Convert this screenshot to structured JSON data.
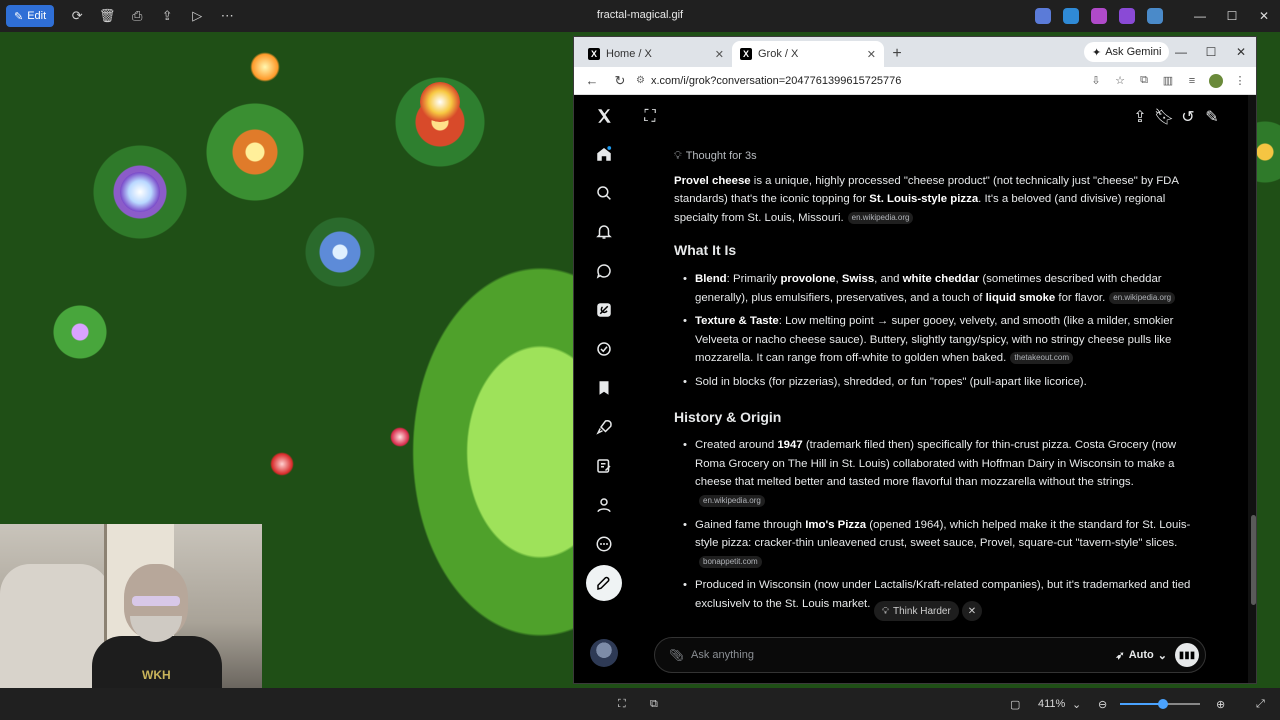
{
  "viewer": {
    "edit_label": "Edit",
    "title": "fractal-magical.gif",
    "zoom": "411%"
  },
  "webcam": {
    "shirt_text": "WKH"
  },
  "browser": {
    "tabs": [
      {
        "title": "Home / X",
        "active": false
      },
      {
        "title": "Grok / X",
        "active": true
      }
    ],
    "ask_gemini": "Ask Gemini",
    "url": "x.com/i/grok?conversation=2047761399615725776"
  },
  "grok": {
    "thought": "Thought for 3s",
    "intro": {
      "b1": "Provel cheese",
      "t1": " is a unique, highly processed \"cheese product\" (not technically just \"cheese\" by FDA standards) that's the iconic topping for ",
      "b2": "St. Louis-style pizza",
      "t2": ". It's a beloved (and divisive) regional specialty from St. Louis, Missouri.",
      "src": "en.wikipedia.org"
    },
    "section1": {
      "heading": "What It Is",
      "blend": {
        "label": "Blend",
        "t1": ": Primarily ",
        "b1": "provolone",
        "t2": ", ",
        "b2": "Swiss",
        "t3": ", and ",
        "b3": "white cheddar",
        "t4": " (sometimes described with cheddar generally), plus emulsifiers, preservatives, and a touch of ",
        "b4": "liquid smoke",
        "t5": " for flavor.",
        "src": "en.wikipedia.org"
      },
      "texture": {
        "label": "Texture & Taste",
        "t1": ": Low melting point → super gooey, velvety, and smooth (like a milder, smokier Velveeta or nacho cheese sauce). Buttery, slightly tangy/spicy, with no stringy cheese pulls like mozzarella. It can range from off-white to golden when baked.",
        "src": "thetakeout.com"
      },
      "sold": "Sold in blocks (for pizzerias), shredded, or fun \"ropes\" (pull-apart like licorice)."
    },
    "section2": {
      "heading": "History & Origin",
      "created": {
        "t1": "Created around ",
        "b1": "1947",
        "t2": " (trademark filed then) specifically for thin-crust pizza. Costa Grocery (now Roma Grocery on The Hill in St. Louis) collaborated with Hoffman Dairy in Wisconsin to make a cheese that melted better and tasted more flavorful than mozzarella without the strings.",
        "src": "en.wikipedia.org"
      },
      "fame": {
        "t1": "Gained fame through ",
        "b1": "Imo's Pizza",
        "t2": " (opened 1964), which helped make it the standard for St. Louis-style pizza: cracker-thin unleavened crust, sweet sauce, Provel, square-cut \"tavern-style\" slices.",
        "src": "bonappetit.com"
      },
      "produced": "Produced in Wisconsin (now under Lactalis/Kraft-related companies), but it's trademarked and tied exclusively to the St. Louis market."
    },
    "think_harder": "Think Harder",
    "ask_placeholder": "Ask anything",
    "mode": "Auto"
  },
  "colors": {
    "accent": "#1d9bf0",
    "viewer_edit": "#2f6fd6",
    "grok_bg": "#000000"
  }
}
